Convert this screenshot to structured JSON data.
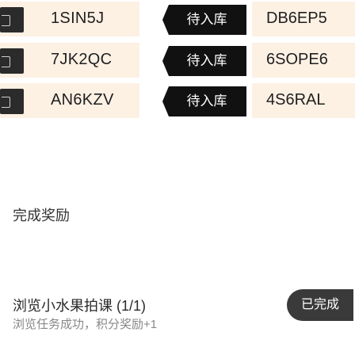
{
  "rows": [
    {
      "code": "1SIN5J",
      "tag": "待入库",
      "code_right": "DB6EP5"
    },
    {
      "code": "7JK2QC",
      "tag": "待入库",
      "code_right": "6SOPE6"
    },
    {
      "code": "AN6KZV",
      "tag": "待入库",
      "code_right": "4S6RAL"
    }
  ],
  "section": {
    "title": "完成奖励"
  },
  "footer": {
    "title": "浏览小水果拍课 (1/1)",
    "subtitle": "浏览任务成功，积分奖励+1",
    "done_label": "已完成"
  }
}
